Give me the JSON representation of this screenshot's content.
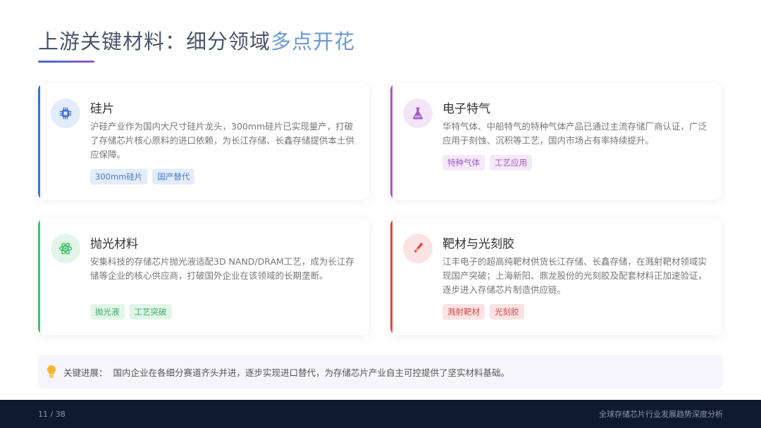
{
  "header": {
    "title_main": "上游关键材料：细分领域",
    "title_highlight": "多点开花"
  },
  "cards": [
    {
      "title": "硅片",
      "icon": "chip-icon",
      "desc": "沪硅产业作为国内大尺寸硅片龙头，300mm硅片已实现量产，打破了存储芯片核心原料的进口依赖，为长江存储、长鑫存储提供本土供应保障。",
      "tags": [
        "300mm硅片",
        "国产替代"
      ],
      "accent": "#3b6fd4"
    },
    {
      "title": "电子特气",
      "icon": "flask-icon",
      "desc": "华特气体、中船特气的特种气体产品已通过主流存储厂商认证，广泛应用于刻蚀、沉积等工艺，国内市场占有率持续提升。",
      "tags": [
        "特种气体",
        "工艺应用"
      ],
      "accent": "#a25cc8"
    },
    {
      "title": "抛光材料",
      "icon": "atom-icon",
      "desc": "安集科技的存储芯片抛光液适配3D NAND/DRAM工艺，成为长江存储等企业的核心供应商，打破国外企业在该领域的长期垄断。",
      "tags": [
        "抛光液",
        "工艺突破"
      ],
      "accent": "#3fbf6a"
    },
    {
      "title": "靶材与光刻胶",
      "icon": "test-tube-icon",
      "desc": "江丰电子的超高纯靶材供货长江存储、长鑫存储，在溅射靶材领域实现国产突破；上海新阳、鼎龙股份的光刻胶及配套材料正加速验证，逐步进入存储芯片制造供应链。",
      "tags": [
        "溅射靶材",
        "光刻胶"
      ],
      "accent": "#d84a4a"
    }
  ],
  "note": {
    "icon": "lightbulb-icon",
    "label": "关键进展：",
    "text": "国内企业在各细分赛道齐头并进，逐步实现进口替代，为存储芯片产业自主可控提供了坚实材料基础。"
  },
  "footer": {
    "page": "11 / 38",
    "doc_title": "全球存储芯片行业发展趋势深度分析"
  }
}
